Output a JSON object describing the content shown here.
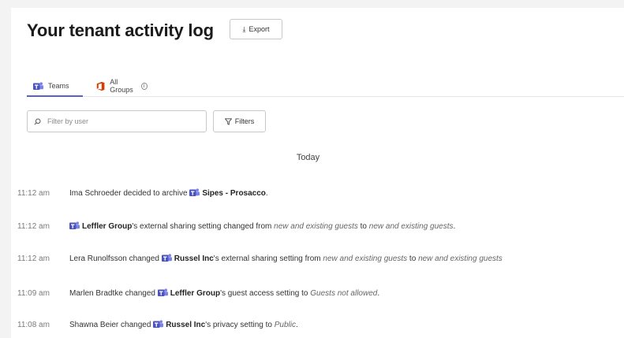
{
  "header": {
    "title": "Your tenant activity log",
    "export_label": "Export"
  },
  "tabs": [
    {
      "label": "Teams",
      "icon": "teams-icon",
      "active": true
    },
    {
      "label": "All Groups",
      "icon": "office-icon",
      "active": false
    }
  ],
  "filter": {
    "placeholder": "Filter by user",
    "filters_label": "Filters"
  },
  "day_header": "Today",
  "colors": {
    "accent": "#5b5fc7",
    "teams": "#4b53bc",
    "office": "#d83b01"
  },
  "log": [
    {
      "time": "11:12 am",
      "parts": [
        {
          "t": "Ima Schroeder decided to archive "
        },
        {
          "icon": "teams-icon"
        },
        {
          "t": "Sipes - Prosacco",
          "b": true
        },
        {
          "t": "."
        }
      ]
    },
    {
      "time": "11:12 am",
      "parts": [
        {
          "icon": "teams-icon"
        },
        {
          "t": "Leffler Group",
          "b": true
        },
        {
          "t": "'s external sharing setting changed from "
        },
        {
          "t": "new and existing guests",
          "i": true
        },
        {
          "t": " to "
        },
        {
          "t": "new and existing guests",
          "i": true
        },
        {
          "t": "."
        }
      ]
    },
    {
      "time": "11:12 am",
      "parts": [
        {
          "t": "Lera Runolfsson changed "
        },
        {
          "icon": "teams-icon"
        },
        {
          "t": "Russel Inc",
          "b": true
        },
        {
          "t": "'s external sharing setting from "
        },
        {
          "t": "new and existing guests",
          "i": true
        },
        {
          "t": " to "
        },
        {
          "t": "new and existing guests",
          "i": true
        }
      ]
    },
    {
      "time": "11:09 am",
      "parts": [
        {
          "t": "Marlen Bradtke changed "
        },
        {
          "icon": "teams-icon"
        },
        {
          "t": "Leffler Group",
          "b": true
        },
        {
          "t": "'s guest access setting to "
        },
        {
          "t": "Guests not allowed",
          "i": true
        },
        {
          "t": "."
        }
      ]
    },
    {
      "time": "11:08 am",
      "parts": [
        {
          "t": "Shawna Beier changed "
        },
        {
          "icon": "teams-icon"
        },
        {
          "t": "Russel Inc",
          "b": true
        },
        {
          "t": "'s privacy setting to "
        },
        {
          "t": "Public",
          "i": true
        },
        {
          "t": "."
        }
      ]
    }
  ]
}
